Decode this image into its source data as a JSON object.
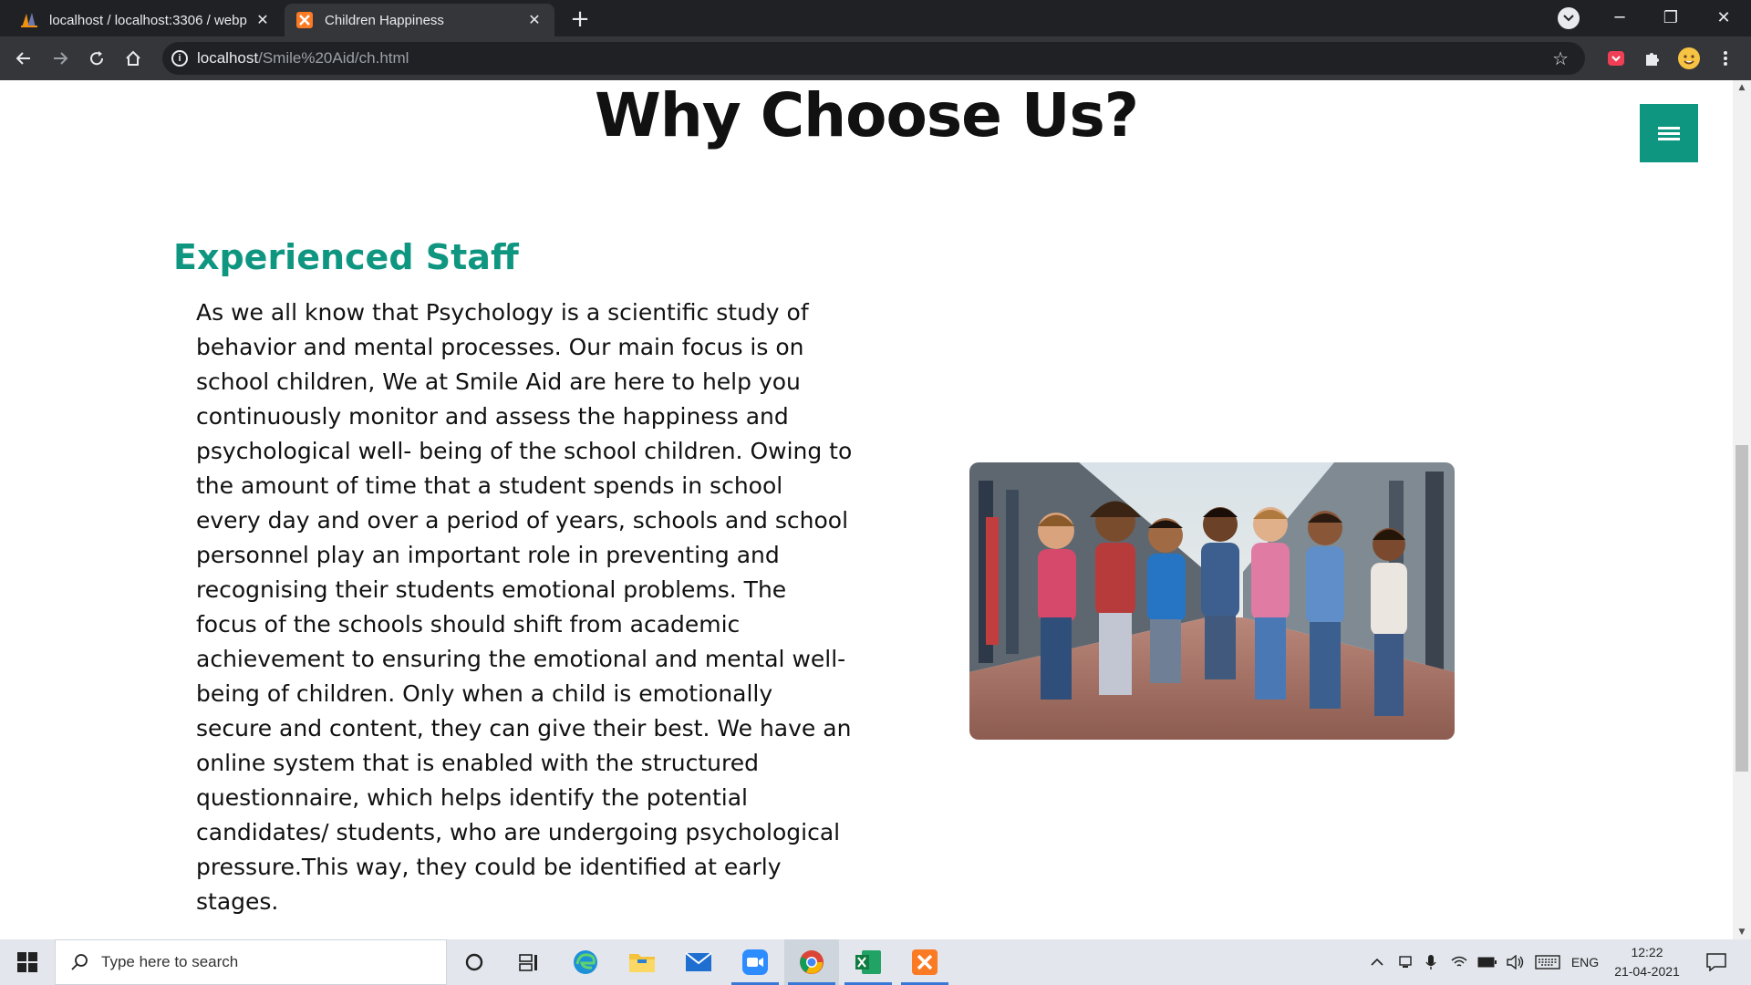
{
  "browser": {
    "tabs": [
      {
        "label": "localhost / localhost:3306 / webp",
        "favicon": "phpmyadmin-icon",
        "active": false
      },
      {
        "label": "Children Happiness",
        "favicon": "xampp-icon",
        "active": true
      }
    ],
    "new_tab_label": "+",
    "url_host": "localhost",
    "url_path": "/Smile%20Aid/ch.html"
  },
  "page": {
    "heading": "Why Choose Us?",
    "section_title": "Experienced Staff",
    "paragraph": "As we all know that Psychology is a scientific study of behavior and mental processes. Our main focus is on school children, We at Smile Aid are here to help you continuously monitor and assess the happiness and psychological well- being of the school children. Owing to the amount of time that a student spends in school every day and over a period of years, schools and school personnel play an important role in preventing and recognising their students emotional problems. The focus of the schools should shift from academic achievement to ensuring the emotional and mental well-being of children. Only when a child is emotionally secure and content, they can give their best. We have an online system that is enabled with the structured questionnaire, which helps identify the potential candidates/ students, who are undergoing psychological pressure.This way, they could be identified at early stages.",
    "accent_color": "#0f9680"
  },
  "taskbar": {
    "search_placeholder": "Type here to search",
    "language": "ENG",
    "time": "12:22",
    "date": "21-04-2021"
  }
}
